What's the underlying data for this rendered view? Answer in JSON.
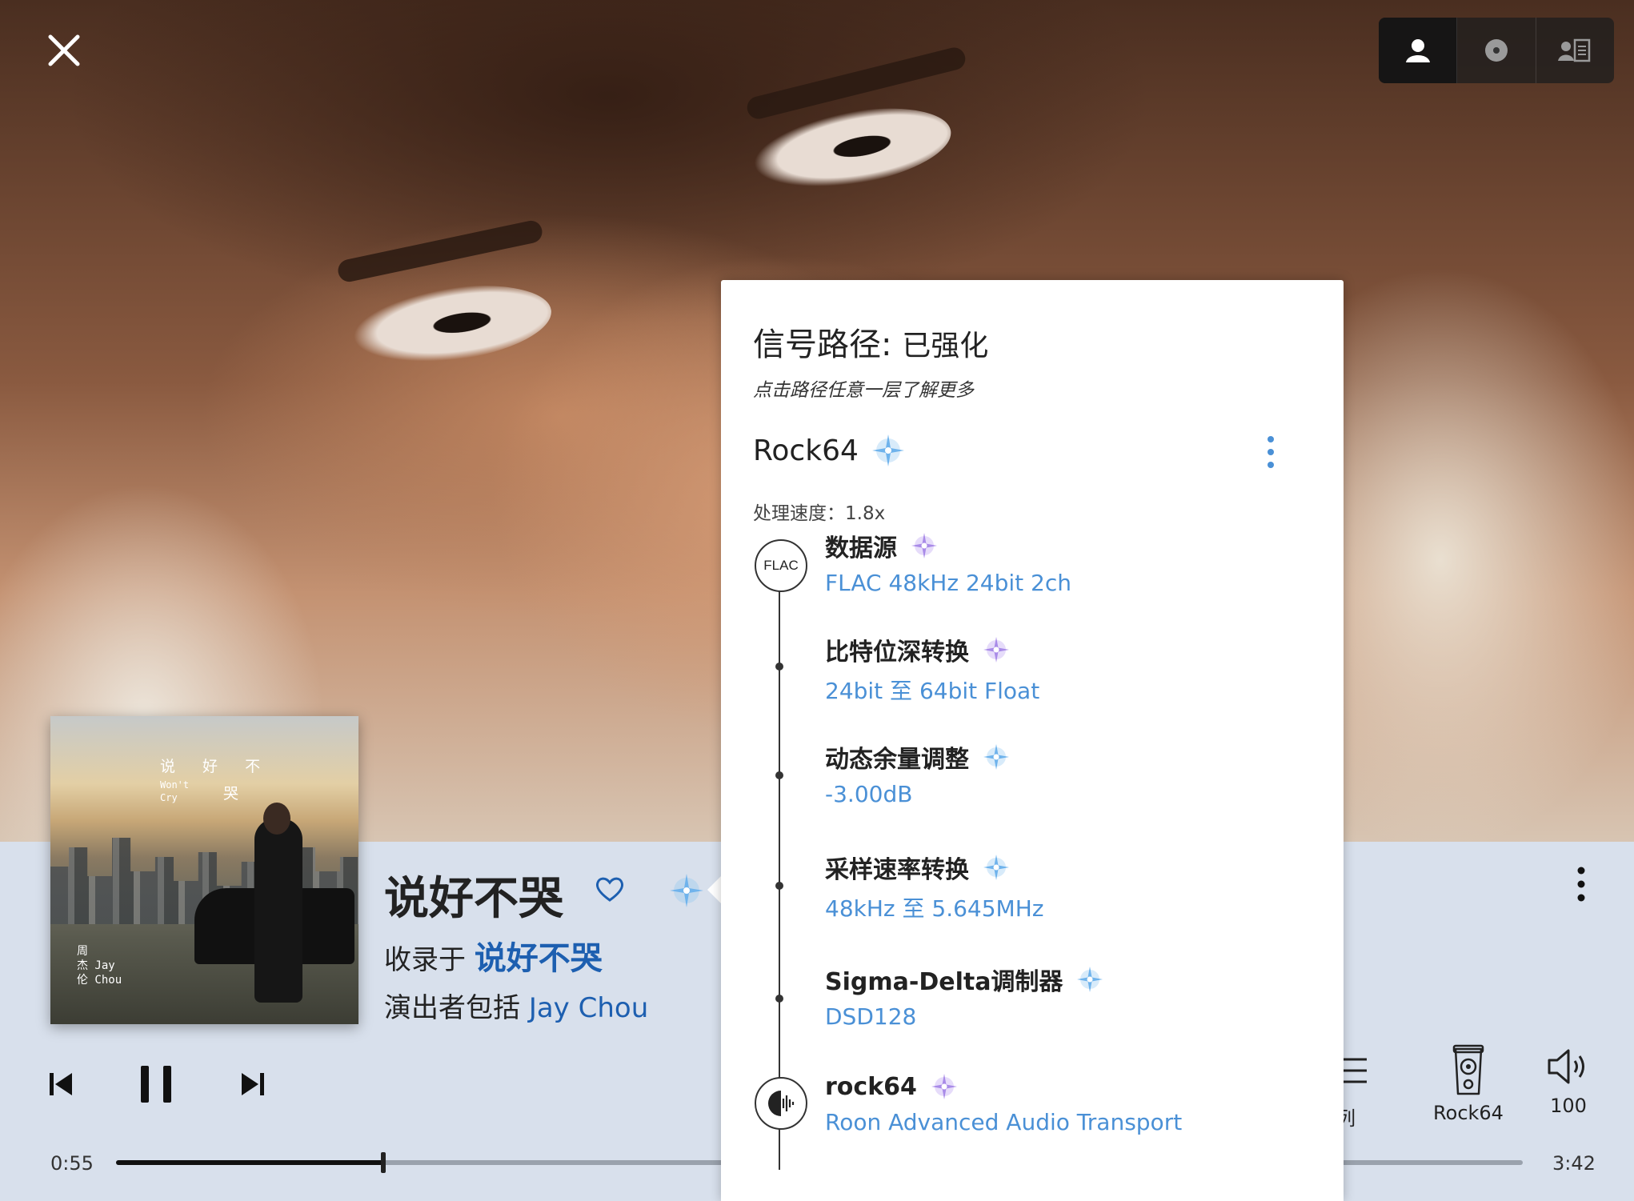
{
  "window": {
    "close_icon": "close-icon"
  },
  "view_switcher": [
    {
      "icon": "person-icon",
      "active": true
    },
    {
      "icon": "disc-icon",
      "active": false
    },
    {
      "icon": "artist-bio-icon",
      "active": false
    }
  ],
  "album_art": {
    "title_text": "说 好 不",
    "subtitle_text": "Won't\nCry",
    "title_text_2": "哭",
    "artist_text": "周\n杰 Jay\n伦 Chou"
  },
  "now_playing": {
    "title": "说好不哭",
    "album_prefix": "收录于",
    "album_name": "说好不哭",
    "artist_prefix": "演出者包括",
    "artist_name": "Jay Chou",
    "favorite_icon": "heart-outline-icon",
    "quality_icon": "sparkle-icon"
  },
  "transport": {
    "prev_icon": "skip-previous-icon",
    "pause_icon": "pause-icon",
    "next_icon": "skip-next-icon",
    "elapsed": "0:55",
    "total": "3:42",
    "progress": 0.19
  },
  "right_controls": {
    "queue_label": "列",
    "zone_label": "Rock64",
    "volume_value": "100"
  },
  "signal_path": {
    "title": "信号路径:",
    "status": "已强化",
    "hint": "点击路径任意一层了解更多",
    "zone_name": "Rock64",
    "processing_speed": "处理速度：1.8x",
    "source_icon_label": "FLAC",
    "steps": [
      {
        "name": "数据源",
        "detail": "FLAC 48kHz 24bit 2ch",
        "quality": "enhanced"
      },
      {
        "name": "比特位深转换",
        "detail": "24bit 至 64bit Float",
        "quality": "enhanced"
      },
      {
        "name": "动态余量调整",
        "detail": "-3.00dB",
        "quality": "high"
      },
      {
        "name": "采样速率转换",
        "detail": "48kHz 至 5.645MHz",
        "quality": "high"
      },
      {
        "name": "Sigma-Delta调制器",
        "detail": "DSD128",
        "quality": "high"
      },
      {
        "name": "rock64",
        "detail": "Roon Advanced Audio Transport",
        "quality": "enhanced"
      }
    ]
  },
  "colors": {
    "link_blue": "#1d5fb0",
    "detail_blue": "#4a90d6",
    "panel_bg": "#d8e0ec",
    "spark_blue": "#8ec5f0",
    "spark_purple": "#b79af0"
  }
}
